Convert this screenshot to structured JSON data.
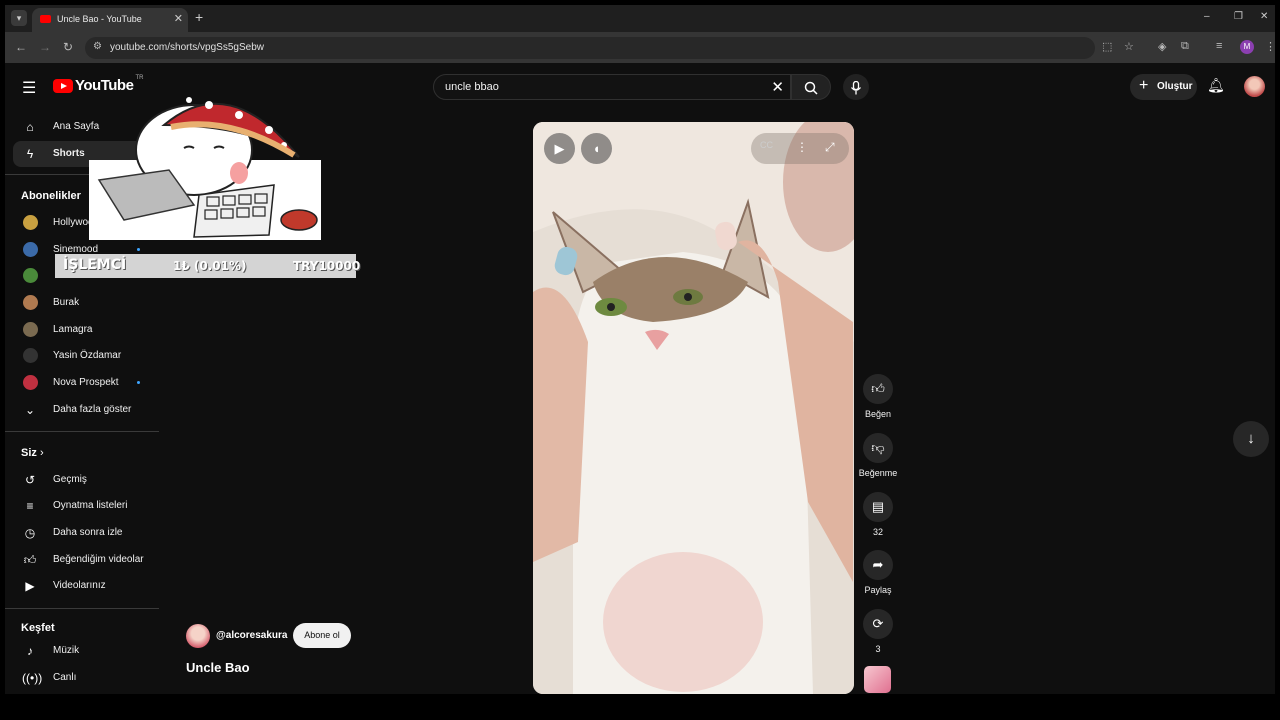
{
  "browser": {
    "tab_title": "Uncle Bao - YouTube",
    "tab_close": "✕",
    "new_tab": "+",
    "url": "youtube.com/shorts/vpgSs5gSebw",
    "window_controls": [
      "–",
      "❐",
      "✕"
    ],
    "profile_initial": "M"
  },
  "header": {
    "logo_text": "YouTube",
    "country_code": "TR",
    "search_query": "uncle bbao",
    "create_label": "Oluştur"
  },
  "sidebar": {
    "main": [
      {
        "label": "Ana Sayfa",
        "icon": "home-icon"
      },
      {
        "label": "Shorts",
        "icon": "shorts-icon"
      }
    ],
    "subscriptions_heading": "Abonelikler",
    "subscriptions": [
      {
        "label": "Hollywood",
        "color": "#c8a040"
      },
      {
        "label": "Sinemood",
        "color": "#3b6aa8"
      },
      {
        "label": "",
        "color": "#4a8a3a"
      },
      {
        "label": "Burak",
        "color": "#b07a50"
      },
      {
        "label": "Lamagra",
        "color": "#7a6a50"
      },
      {
        "label": "Yasin Özdamar",
        "color": "#333333"
      },
      {
        "label": "Nova Prospekt",
        "color": "#c03040"
      }
    ],
    "show_more": "Daha fazla göster",
    "you_heading": "Siz",
    "you_items": [
      {
        "label": "Geçmiş",
        "icon": "history-icon"
      },
      {
        "label": "Oynatma listeleri",
        "icon": "playlist-icon"
      },
      {
        "label": "Daha sonra izle",
        "icon": "clock-icon"
      },
      {
        "label": "Beğendiğim videolar",
        "icon": "like-icon"
      },
      {
        "label": "Videolarınız",
        "icon": "your-videos-icon"
      }
    ],
    "explore_heading": "Keşfet",
    "explore_items": [
      {
        "label": "Müzik",
        "icon": "music-icon"
      },
      {
        "label": "Canlı",
        "icon": "live-icon"
      }
    ]
  },
  "overlay": {
    "ticker_name": "İŞLEMCİ",
    "ticker_price": "1₺ (0.01%)",
    "ticker_total": "TRY10000"
  },
  "short": {
    "channel": "@alcoresakura",
    "subscribe_label": "Abone ol",
    "title": "Uncle Bao"
  },
  "actions": {
    "like": "Beğen",
    "dislike": "Beğenme",
    "comments": "32",
    "share": "Paylaş",
    "remix": "3"
  }
}
